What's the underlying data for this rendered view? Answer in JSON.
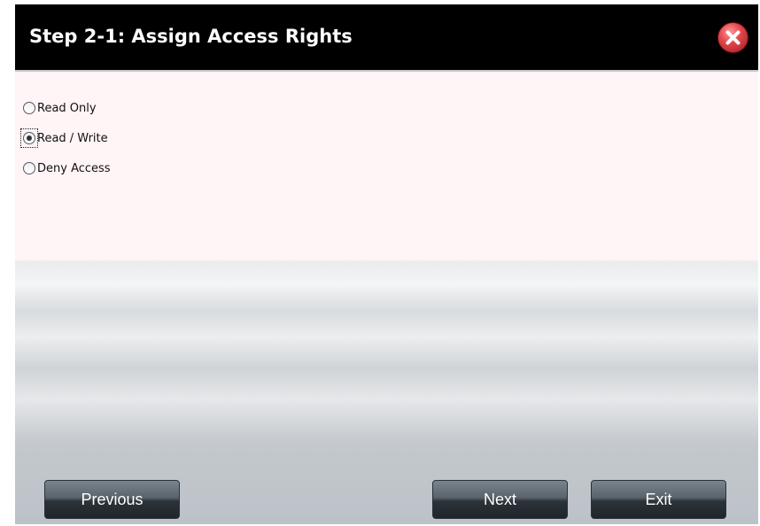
{
  "dialog": {
    "title": "Step 2-1: Assign Access Rights"
  },
  "access_options": [
    {
      "label": "Read Only",
      "checked": false
    },
    {
      "label": "Read / Write",
      "checked": true
    },
    {
      "label": "Deny Access",
      "checked": false
    }
  ],
  "buttons": {
    "previous": "Previous",
    "next": "Next",
    "exit": "Exit"
  },
  "icons": {
    "close": "close-icon"
  },
  "colors": {
    "titlebar": "#000000",
    "content_top": "#fff4f6",
    "close_red": "#e3484b",
    "button_dark": "#2b3338"
  }
}
